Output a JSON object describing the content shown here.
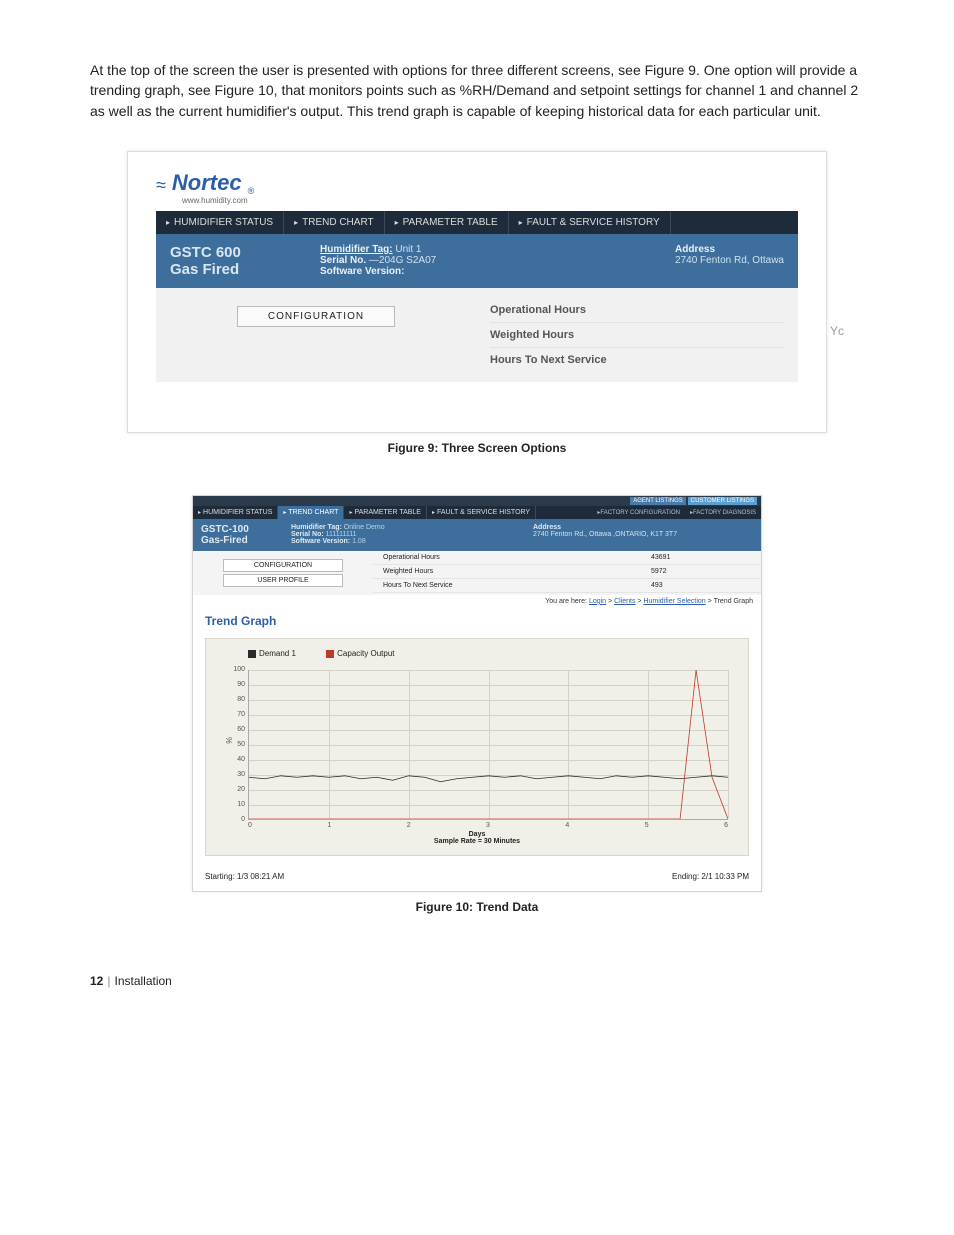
{
  "intro": "At the top of the screen the user is presented with options for three different screens, see Figure 9.   One option will provide a trending graph, see Figure 10, that monitors points such as %RH/Demand and setpoint settings for channel 1 and channel 2 as well as the current humidifier's output. This trend graph is capable of keeping historical data for each particular unit.",
  "figure9": {
    "caption": "Figure 9:   Three Screen Options",
    "brand_name": "Nortec",
    "brand_url": "www.humidity.com",
    "tabs": [
      "HUMIDIFIER STATUS",
      "TREND CHART",
      "PARAMETER TABLE",
      "FAULT & SERVICE HISTORY"
    ],
    "model": "GSTC 600",
    "type": "Gas Fired",
    "mid": {
      "tag_label": "Humidifier Tag:",
      "tag_value": "Unit 1",
      "serial_label": "Serial No.",
      "serial_value": "—204G S2A07",
      "sw_label": "Software Version:"
    },
    "right": {
      "addr_label": "Address",
      "addr_value": "2740 Fenton Rd, Ottawa"
    },
    "config_button": "CONFIGURATION",
    "rows": [
      "Operational Hours",
      "Weighted Hours",
      "Hours To Next Service"
    ],
    "clipped": "Yc"
  },
  "figure10": {
    "caption": "Figure 10:   Trend Data",
    "top_tabs": {
      "agent": "AGENT LISTINGS",
      "customer": "CUSTOMER LISTINGS"
    },
    "nav": [
      "HUMIDIFIER STATUS",
      "TREND CHART",
      "PARAMETER TABLE",
      "FAULT & SERVICE HISTORY"
    ],
    "sublinks": [
      "FACTORY CONFIGURATION",
      "FACTORY DIAGNOSIS"
    ],
    "model": "GSTC-100",
    "type": "Gas-Fired",
    "mid": {
      "tag_label": "Humidifier Tag:",
      "tag_value": "Online Demo",
      "serial_label": "Serial No:",
      "serial_value": "111111111",
      "sw_label": "Software Version:",
      "sw_value": "1.08"
    },
    "right": {
      "addr_label": "Address",
      "addr_value": "2740 Fenton Rd., Ottawa ,ONTARIO, K1T 3T7"
    },
    "buttons": [
      "CONFIGURATION",
      "USER PROFILE"
    ],
    "stats": [
      {
        "label": "Operational Hours",
        "value": "43691"
      },
      {
        "label": "Weighted Hours",
        "value": "5972"
      },
      {
        "label": "Hours To Next Service",
        "value": "493"
      }
    ],
    "breadcrumb": {
      "prefix": "You are here:",
      "path": [
        "Login",
        "Clients",
        "Humidifier Selection",
        "Trend Graph"
      ]
    },
    "trend_title": "Trend Graph",
    "legend": {
      "demand1": "Demand 1",
      "capacity": "Capacity Output"
    },
    "xlabel": "Days",
    "sample": "Sample Rate = 30 Minutes",
    "start": "Starting: 1/3 08:21 AM",
    "end": "Ending: 2/1 10:33 PM"
  },
  "chart_data": {
    "type": "line",
    "x": [
      0,
      1,
      2,
      3,
      4,
      5,
      6
    ],
    "ylim": [
      0,
      100
    ],
    "yticks": [
      0,
      10,
      20,
      30,
      40,
      50,
      60,
      70,
      80,
      90,
      100
    ],
    "ylabel": "%",
    "series": [
      {
        "name": "Demand 1",
        "color": "#2a2a2a",
        "values": [
          28,
          27,
          29,
          28,
          29,
          28,
          29,
          27,
          28,
          26,
          29,
          28,
          25,
          27,
          28,
          29,
          28,
          29,
          27,
          28,
          29,
          28,
          27,
          29,
          28,
          29,
          28,
          27,
          28,
          29,
          28
        ]
      },
      {
        "name": "Capacity Output",
        "color": "#c0392b",
        "values": [
          0,
          0,
          0,
          0,
          0,
          0,
          0,
          0,
          0,
          0,
          0,
          0,
          0,
          0,
          0,
          0,
          0,
          0,
          0,
          0,
          0,
          0,
          0,
          0,
          0,
          0,
          0,
          0,
          100,
          28,
          0
        ]
      }
    ]
  },
  "footer": {
    "page": "12",
    "section": "Installation"
  }
}
